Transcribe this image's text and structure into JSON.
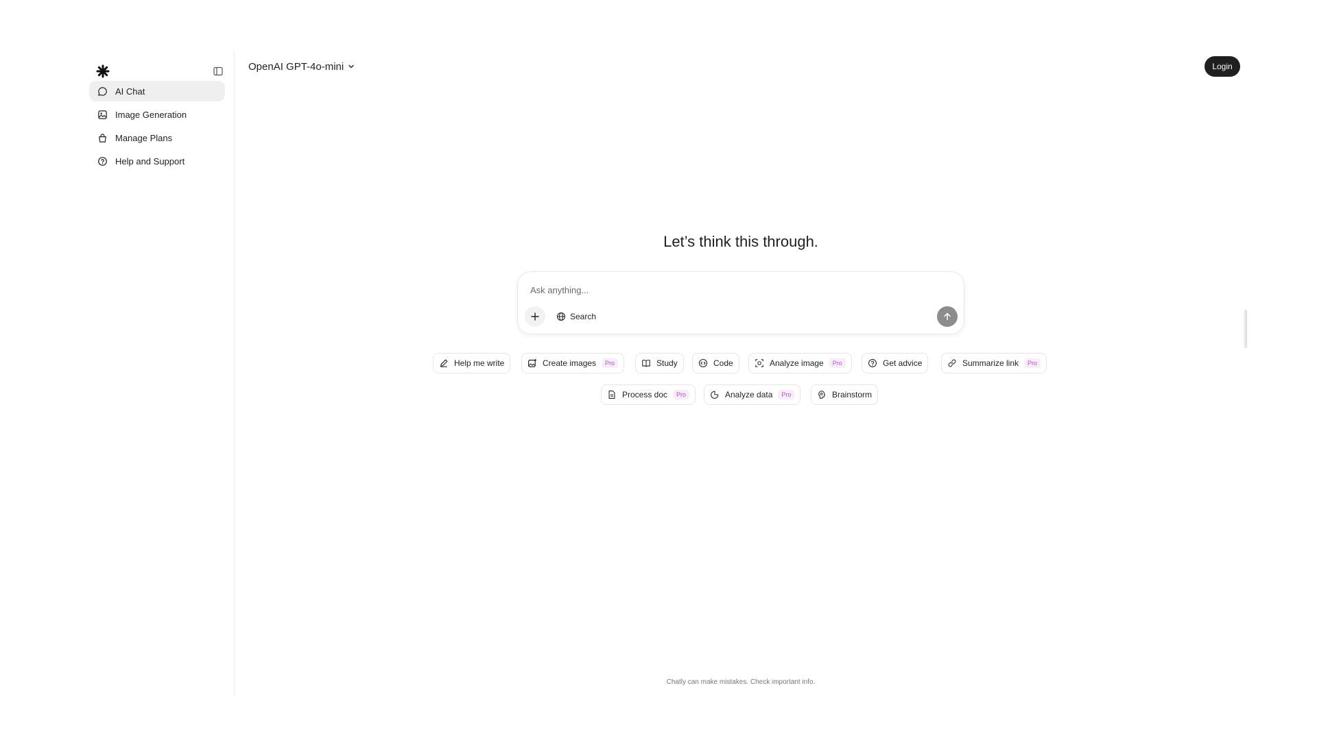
{
  "sidebar": {
    "logo_icon": "asterisk-logo-icon",
    "collapse_icon": "sidebar-panel-icon",
    "items": [
      {
        "label": "AI Chat",
        "icon": "chat-bubble-icon",
        "active": true
      },
      {
        "label": "Image Generation",
        "icon": "image-icon",
        "active": false
      },
      {
        "label": "Manage Plans",
        "icon": "bag-icon",
        "active": false
      },
      {
        "label": "Help and Support",
        "icon": "help-circle-icon",
        "active": false
      }
    ]
  },
  "header": {
    "model_label": "OpenAI GPT-4o-mini",
    "login_label": "Login"
  },
  "main": {
    "headline": "Let’s think this through.",
    "composer": {
      "placeholder": "Ask anything...",
      "search_label": "Search"
    },
    "chips_row1": [
      {
        "label": "Help me write",
        "icon": "pen-icon",
        "pro": ""
      },
      {
        "label": "Create images",
        "icon": "image-plus-icon",
        "pro": "Pro"
      },
      {
        "label": "Study",
        "icon": "book-icon",
        "pro": ""
      },
      {
        "label": "Code",
        "icon": "code-icon",
        "pro": ""
      },
      {
        "label": "Analyze image",
        "icon": "scan-icon",
        "pro": "Pro"
      },
      {
        "label": "Get advice",
        "icon": "help-circle-icon",
        "pro": ""
      },
      {
        "label": "Summarize link",
        "icon": "link-icon",
        "pro": "Pro"
      }
    ],
    "chips_row2": [
      {
        "label": "Process doc",
        "icon": "document-icon",
        "pro": "Pro"
      },
      {
        "label": "Analyze data",
        "icon": "pie-chart-icon",
        "pro": "Pro"
      },
      {
        "label": "Brainstorm",
        "icon": "brain-icon",
        "pro": ""
      }
    ],
    "footnote": "Chatly can make mistakes. Check important info."
  },
  "colors": {
    "accent_dark": "#1f1f1f",
    "pro_text": "#b153c9",
    "pro_bg": "#f6edf9",
    "active_nav_bg": "#efefef",
    "send_button": "#8c8c8c"
  }
}
